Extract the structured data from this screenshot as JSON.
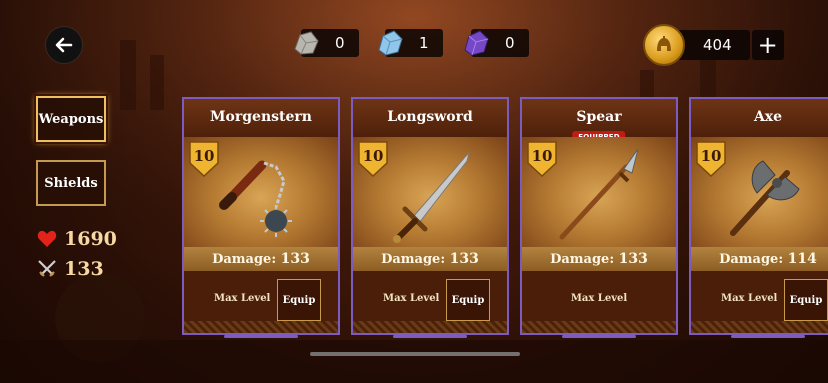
{
  "header": {
    "resources": [
      {
        "icon": "stone-ore-icon",
        "value": "0"
      },
      {
        "icon": "crystal-ore-icon",
        "value": "1"
      },
      {
        "icon": "amethyst-ore-icon",
        "value": "0"
      }
    ],
    "gold": {
      "icon": "gold-helmet-coin-icon",
      "value": "404",
      "add_label": "+"
    }
  },
  "tabs": [
    {
      "label": "Weapons",
      "active": true
    },
    {
      "label": "Shields",
      "active": false
    }
  ],
  "stats": {
    "health": {
      "icon": "heart-icon",
      "value": "1690"
    },
    "attack": {
      "icon": "crossed-swords-icon",
      "value": "133"
    }
  },
  "cards": [
    {
      "name": "Morgenstern",
      "level": "10",
      "damage_label": "Damage:",
      "damage": "133",
      "max_level_label": "Max Level",
      "equip_label": "Equip",
      "equipped": false,
      "icon": "morning-star-icon"
    },
    {
      "name": "Longsword",
      "level": "10",
      "damage_label": "Damage:",
      "damage": "133",
      "max_level_label": "Max Level",
      "equip_label": "Equip",
      "equipped": false,
      "icon": "longsword-icon"
    },
    {
      "name": "Spear",
      "level": "10",
      "damage_label": "Damage:",
      "damage": "133",
      "max_level_label": "Max Level",
      "equip_label": "",
      "equipped": true,
      "equipped_label": "EQUIPPED",
      "icon": "spear-icon"
    },
    {
      "name": "Axe",
      "level": "10",
      "damage_label": "Damage:",
      "damage": "114",
      "max_level_label": "Max Level",
      "equip_label": "Equip",
      "equipped": false,
      "icon": "battle-axe-icon"
    }
  ],
  "colors": {
    "card_border": "#7d5cc0",
    "gold_frame": "#c69a4e",
    "equipped_badge": "#c21c12"
  }
}
